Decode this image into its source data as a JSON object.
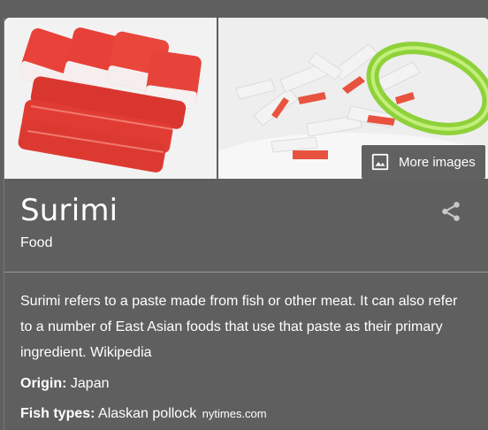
{
  "images": {
    "left_image_icon": "crab-stick-image",
    "right_image_icon": "surimi-salad-image",
    "more_images_label": "More images",
    "more_images_icon": "image-icon"
  },
  "entity": {
    "title": "Surimi",
    "category": "Food",
    "share_icon": "share-icon"
  },
  "description": {
    "text": "Surimi refers to a paste made from fish or other meat. It can also refer to a number of East Asian foods that use that paste as their primary ingredient.",
    "source": "Wikipedia"
  },
  "facts": [
    {
      "label": "Origin:",
      "value": "Japan",
      "source": ""
    },
    {
      "label": "Fish types:",
      "value": "Alaskan pollock",
      "source": "nytimes.com"
    }
  ],
  "colors": {
    "panel_bg": "#5f5f5f",
    "text": "#ffffff",
    "divider": "#9a9a9a"
  }
}
